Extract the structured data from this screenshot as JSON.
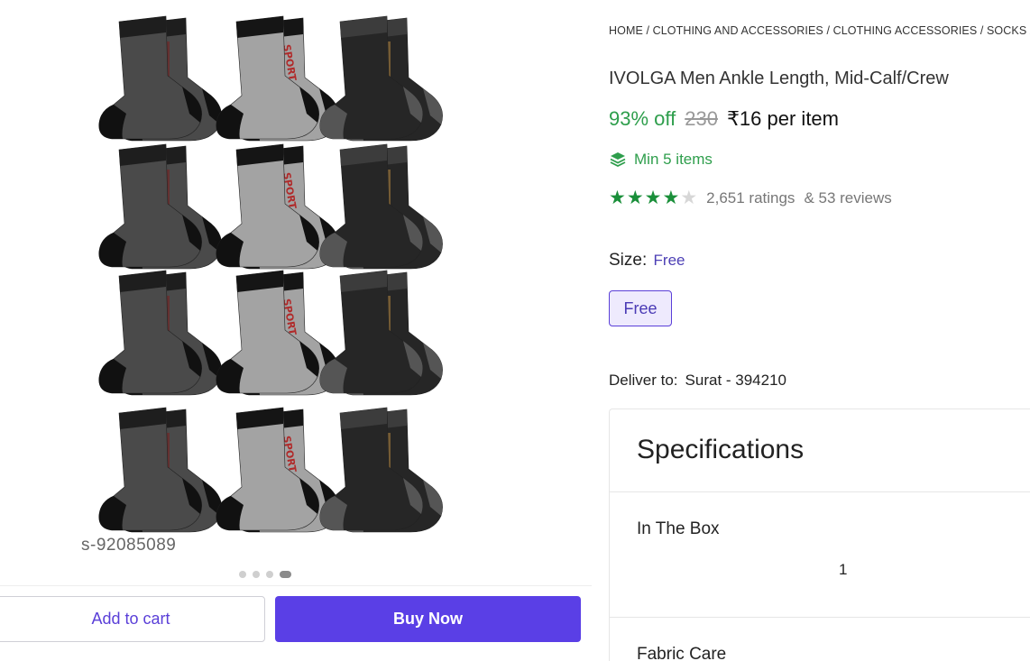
{
  "gallery": {
    "watermark": "s-92085089",
    "image_alt": "pack of socks",
    "sock_text": "SPORT"
  },
  "actions": {
    "add_to_cart": "Add to cart",
    "buy_now": "Buy Now"
  },
  "breadcrumb": [
    "HOME",
    "CLOTHING AND ACCESSORIES",
    "CLOTHING ACCESSORIES",
    "SOCKS"
  ],
  "product": {
    "title": "IVOLGA Men Ankle Length, Mid-Calf/Crew",
    "discount": "93% off",
    "mrp": "230",
    "price": "₹16 per item",
    "min_items": "Min 5 items",
    "rating_value": 4,
    "ratings": "2,651 ratings",
    "reviews": "& 53 reviews"
  },
  "size": {
    "label": "Size:",
    "selected": "Free",
    "option": "Free"
  },
  "delivery": {
    "label": "Deliver to:",
    "location": "Surat - 394210"
  },
  "specifications": {
    "title": "Specifications",
    "rows": [
      {
        "label": "In The Box",
        "value": "1"
      },
      {
        "label": "Fabric Care",
        "value": ""
      }
    ]
  },
  "colors": {
    "accent": "#5a3fe6",
    "green": "#2e9e4c",
    "star": "#1a8f3a"
  }
}
